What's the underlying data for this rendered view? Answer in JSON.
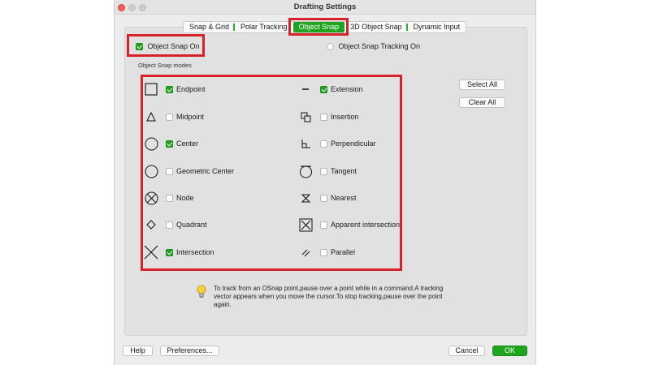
{
  "window": {
    "title": "Drafting Settings"
  },
  "tabs": [
    {
      "label": "Snap & Grid",
      "active": false
    },
    {
      "label": "Polar Tracking",
      "active": false
    },
    {
      "label": "Object Snap",
      "active": true
    },
    {
      "label": "3D Object Snap",
      "active": false
    },
    {
      "label": "Dynamic Input",
      "active": false
    }
  ],
  "object_snap_on": {
    "label": "Object Snap On",
    "checked": true
  },
  "object_snap_tracking_on": {
    "label": "Object Snap Tracking On",
    "checked": false
  },
  "modes_group_label": "Object Snap modes",
  "modes_left": [
    {
      "label": "Endpoint",
      "icon": "endpoint-icon",
      "checked": true
    },
    {
      "label": "Midpoint",
      "icon": "midpoint-icon",
      "checked": false
    },
    {
      "label": "Center",
      "icon": "center-icon",
      "checked": true
    },
    {
      "label": "Geometric Center",
      "icon": "geometric-center-icon",
      "checked": false
    },
    {
      "label": "Node",
      "icon": "node-icon",
      "checked": false
    },
    {
      "label": "Quadrant",
      "icon": "quadrant-icon",
      "checked": false
    },
    {
      "label": "Intersection",
      "icon": "intersection-icon",
      "checked": true
    }
  ],
  "modes_right": [
    {
      "label": "Extension",
      "icon": "extension-icon",
      "checked": true
    },
    {
      "label": "Insertion",
      "icon": "insertion-icon",
      "checked": false
    },
    {
      "label": "Perpendicular",
      "icon": "perpendicular-icon",
      "checked": false
    },
    {
      "label": "Tangent",
      "icon": "tangent-icon",
      "checked": false
    },
    {
      "label": "Nearest",
      "icon": "nearest-icon",
      "checked": false
    },
    {
      "label": "Apparent intersection",
      "icon": "apparent-intersection-icon",
      "checked": false
    },
    {
      "label": "Parallel",
      "icon": "parallel-icon",
      "checked": false
    }
  ],
  "buttons": {
    "select_all": "Select All",
    "clear_all": "Clear All",
    "help": "Help",
    "preferences": "Preferences...",
    "cancel": "Cancel",
    "ok": "OK"
  },
  "tip": {
    "icon": "lightbulb-icon",
    "text": "To track from an OSnap point,pause over a point while in a command.A tracking vector appears when you move the cursor.To stop tracking,pause over the point again."
  },
  "colors": {
    "accent": "#1fa51f",
    "highlight": "#d62228"
  }
}
